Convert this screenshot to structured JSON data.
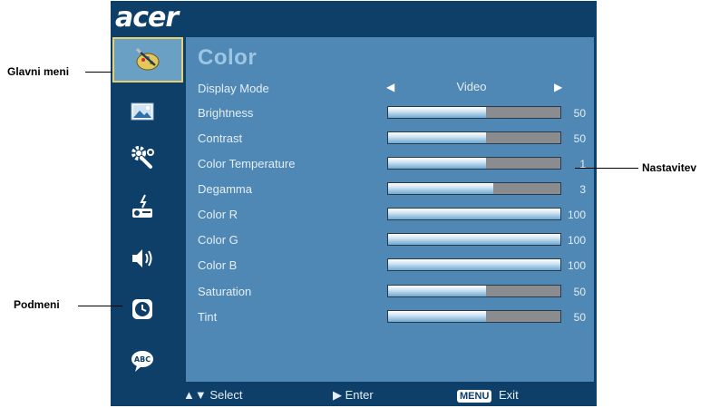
{
  "brand": {
    "logo_text": "acer"
  },
  "sidebar": {
    "items": [
      {
        "name": "color",
        "icon": "paint-palette-icon",
        "selected": true
      },
      {
        "name": "image",
        "icon": "picture-icon",
        "selected": false
      },
      {
        "name": "management",
        "icon": "gear-wrench-icon",
        "selected": false
      },
      {
        "name": "setting",
        "icon": "projector-icon",
        "selected": false
      },
      {
        "name": "audio",
        "icon": "speaker-icon",
        "selected": false
      },
      {
        "name": "timer",
        "icon": "clock-icon",
        "selected": false
      },
      {
        "name": "language",
        "icon": "speech-bubble-abc-icon",
        "selected": false
      }
    ]
  },
  "panel": {
    "title": "Color",
    "display_mode": {
      "label": "Display Mode",
      "value": "Video"
    },
    "rows": [
      {
        "label": "Brightness",
        "value": "50",
        "level": 0.57
      },
      {
        "label": "Contrast",
        "value": "50",
        "level": 0.57
      },
      {
        "label": "Color Temperature",
        "value": "1",
        "level": 0.57
      },
      {
        "label": "Degamma",
        "value": "3",
        "level": 0.61
      },
      {
        "label": "Color R",
        "value": "100",
        "level": 1.0
      },
      {
        "label": "Color G",
        "value": "100",
        "level": 1.0
      },
      {
        "label": "Color B",
        "value": "100",
        "level": 1.0
      },
      {
        "label": "Saturation",
        "value": "50",
        "level": 0.57
      },
      {
        "label": "Tint",
        "value": "50",
        "level": 0.57
      }
    ]
  },
  "footer": {
    "select_label": "Select",
    "enter_label": "Enter",
    "menu_key": "MENU",
    "exit_label": "Exit"
  },
  "callouts": {
    "main_menu": "Glavni meni",
    "submenu": "Podmeni",
    "setting": "Nastavitev"
  },
  "colors": {
    "osd_background": "#0e3f68",
    "panel_background": "#4f88b4",
    "selected_border": "#e8d070",
    "title_color": "#9cc6e3"
  }
}
